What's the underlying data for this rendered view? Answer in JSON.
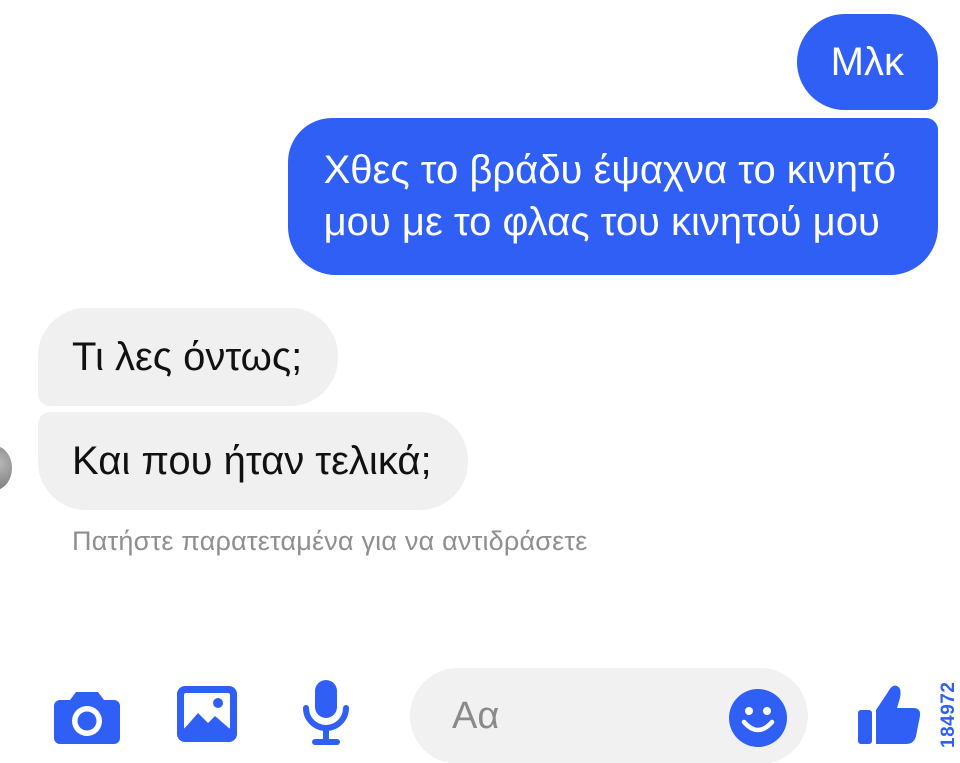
{
  "conversation": {
    "outgoing": [
      {
        "lines": [
          "Μλκ"
        ]
      },
      {
        "lines": [
          "Χθες το βράδυ έψαχνα το κινητό",
          "μου με το φλας του κινητού μου"
        ]
      }
    ],
    "incoming": [
      {
        "lines": [
          "Τι λες όντως;"
        ]
      },
      {
        "lines": [
          "Και που ήταν τελικά;"
        ]
      }
    ],
    "reaction_hint": "Πατήστε παρατεταμένα για να αντιδράσετε"
  },
  "composer": {
    "placeholder": "Αα",
    "icons": [
      "camera-icon",
      "image-gallery-icon",
      "microphone-icon",
      "emoji-icon",
      "thumbs-up-icon"
    ]
  },
  "watermark": "184972",
  "colors": {
    "accent": "#2f5ff5",
    "outgoing_bubble": "#2f5ff5",
    "incoming_bubble": "#f0f0f0",
    "hint_text": "#8e8e93"
  }
}
